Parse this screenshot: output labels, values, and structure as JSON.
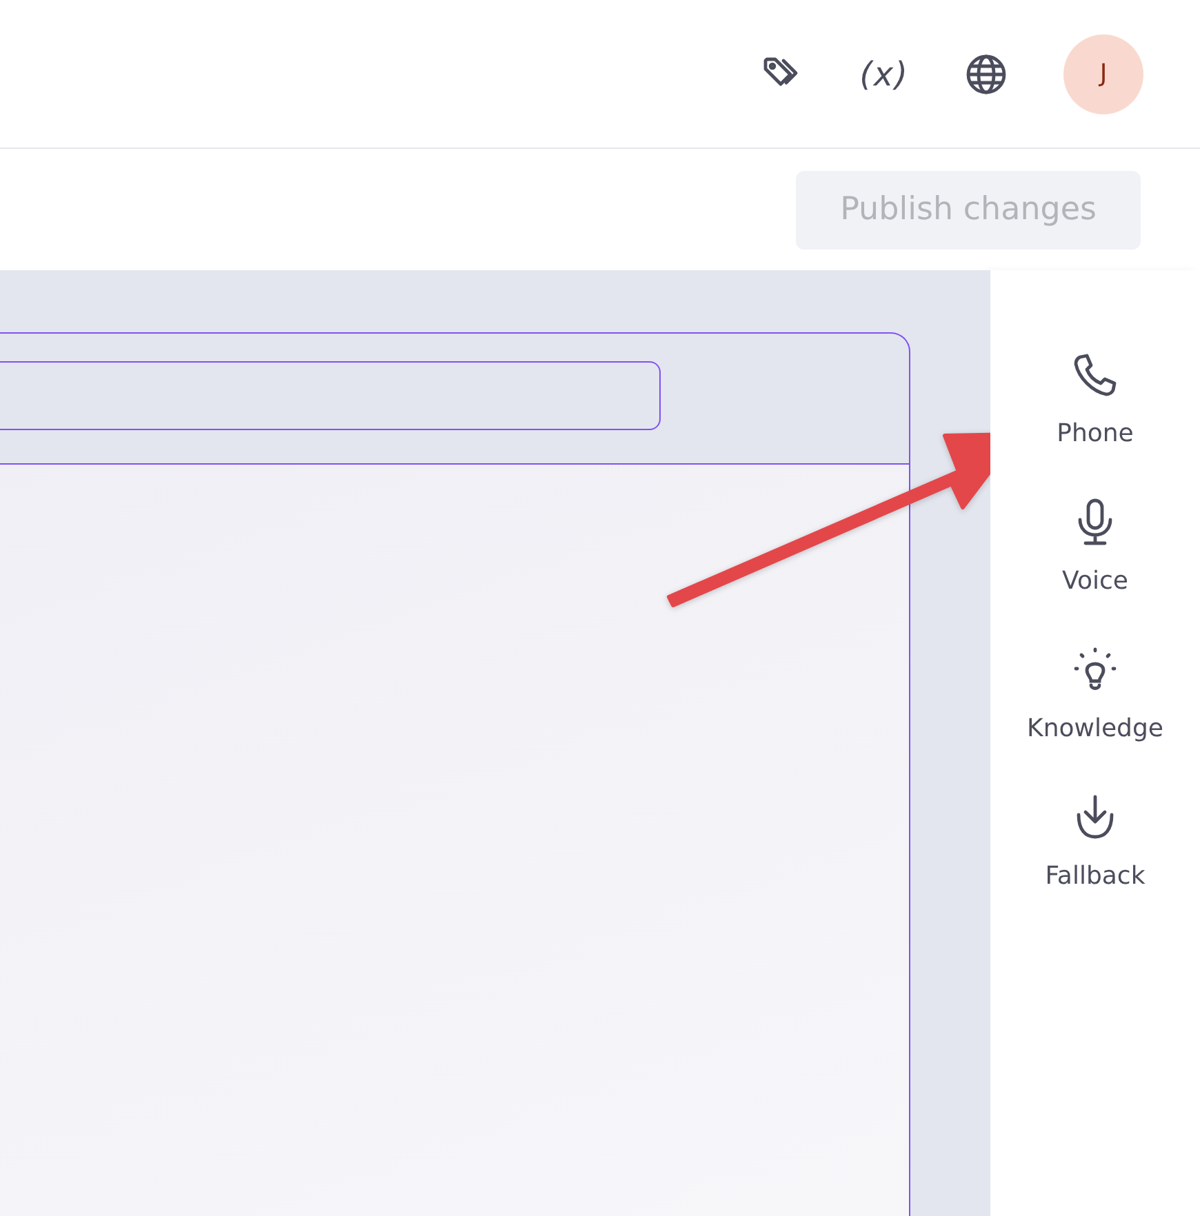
{
  "header": {
    "tools": [
      {
        "kind": "tags"
      },
      {
        "kind": "text",
        "text": "(x)"
      },
      {
        "kind": "globe"
      }
    ],
    "avatar": {
      "initial": "J"
    }
  },
  "toolbar": {
    "publish_button": {
      "label": "Publish changes",
      "disabled": true
    }
  },
  "sidebar": {
    "items": [
      {
        "kind": "phone",
        "label": "Phone"
      },
      {
        "kind": "microphone",
        "label": "Voice"
      },
      {
        "kind": "lightbulb",
        "label": "Knowledge"
      },
      {
        "kind": "download",
        "label": "Fallback"
      }
    ]
  }
}
